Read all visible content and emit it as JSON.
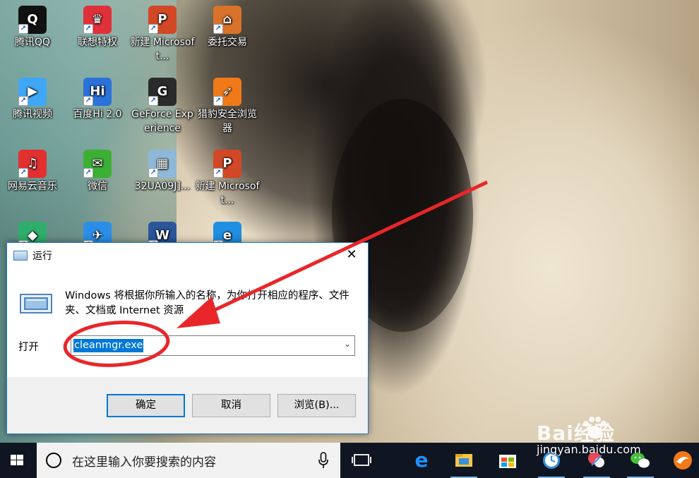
{
  "desktop": {
    "icons": [
      {
        "label": "腾讯QQ",
        "icon": "qq-penguin-icon",
        "color": "#111111"
      },
      {
        "label": "联想特权",
        "icon": "lenovo-privilege-icon",
        "color": "#e0303a"
      },
      {
        "label": "新建 Microsoft...",
        "icon": "powerpoint-file-icon",
        "color": "#d24726"
      },
      {
        "label": "委托交易",
        "icon": "trading-house-icon",
        "color": "#d9722b"
      },
      {
        "label": "腾讯视频",
        "icon": "tencent-video-icon",
        "color": "#3fa7f5"
      },
      {
        "label": "百度Hi 2.0",
        "icon": "baidu-hi-icon",
        "color": "#2a72d9"
      },
      {
        "label": "GeForce Experience",
        "icon": "geforce-icon",
        "color": "#2b2b2b"
      },
      {
        "label": "猎豹安全浏览器",
        "icon": "liebao-browser-icon",
        "color": "#f07a1a"
      },
      {
        "label": "网易云音乐",
        "icon": "netease-music-icon",
        "color": "#e23030"
      },
      {
        "label": "微信",
        "icon": "wechat-icon",
        "color": "#3cb034"
      },
      {
        "label": "32UA09J]...",
        "icon": "image-file-icon",
        "color": "#8fb8d8"
      },
      {
        "label": "新建 Microsoft...",
        "icon": "powerpoint-file-icon",
        "color": "#d24726"
      },
      {
        "label": "",
        "icon": "green-app-icon",
        "color": "#2fae6b"
      },
      {
        "label": "",
        "icon": "blue-bird-app-icon",
        "color": "#2a8ee8"
      },
      {
        "label": "",
        "icon": "word-file-icon",
        "color": "#2b579a"
      },
      {
        "label": "",
        "icon": "internet-explorer-icon",
        "color": "#1e8fe1"
      }
    ]
  },
  "run_dialog": {
    "title": "运行",
    "close_glyph": "✕",
    "description": "Windows 将根据你所输入的名称，为你打开相应的程序、文件夹、文档或 Internet 资源",
    "open_label": "打开",
    "command_value": "cleanmgr.exe",
    "buttons": {
      "ok": "确定",
      "cancel": "取消",
      "browse": "浏览(B)..."
    }
  },
  "taskbar": {
    "search_placeholder": "在这里输入你要搜索的内容",
    "pinned": [
      {
        "icon": "task-view-icon"
      },
      {
        "icon": "edge-browser-icon"
      },
      {
        "icon": "file-explorer-icon"
      },
      {
        "icon": "store-icon"
      },
      {
        "icon": "clock-app-icon"
      },
      {
        "icon": "painting-app-icon"
      },
      {
        "icon": "wechat-taskbar-icon"
      },
      {
        "icon": "liebao-taskbar-icon"
      }
    ]
  },
  "watermark": {
    "brand": "Bai经验",
    "url": "jingyan.baidu.com"
  },
  "colors": {
    "annotation_red": "#e8262a",
    "accent_blue": "#0078d7",
    "taskbar_bg": "#101522"
  }
}
